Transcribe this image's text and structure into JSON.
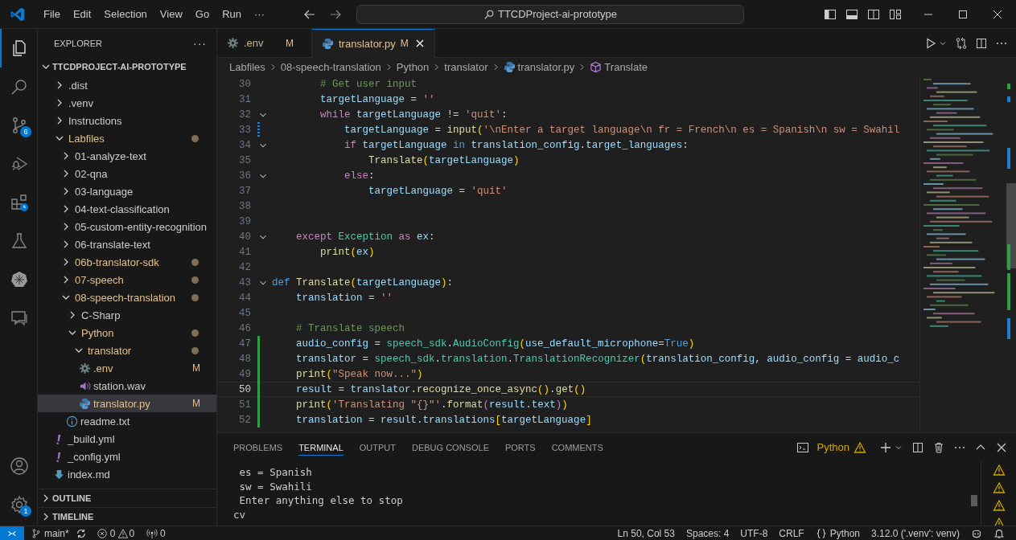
{
  "title_bar": {
    "menus": [
      "File",
      "Edit",
      "Selection",
      "View",
      "Go",
      "Run",
      "···"
    ],
    "search": "TTCDProject-ai-prototype"
  },
  "activity_bar": {
    "items": [
      {
        "kind": "explorer",
        "selected": true
      },
      {
        "kind": "search",
        "selected": false
      },
      {
        "kind": "source-control",
        "selected": false,
        "badge": "6"
      },
      {
        "kind": "run",
        "selected": false
      },
      {
        "kind": "extensions",
        "selected": false
      },
      {
        "kind": "testing",
        "selected": false
      },
      {
        "kind": "kubernetes",
        "selected": false
      },
      {
        "kind": "chat",
        "selected": false
      }
    ],
    "bottom": [
      {
        "kind": "account"
      },
      {
        "kind": "settings",
        "badge": "1"
      }
    ]
  },
  "sidebar": {
    "title": "EXPLORER",
    "more": "···",
    "root": {
      "name": "TTCDPROJECT-AI-PROTOTYPE",
      "expanded": true,
      "children": [
        {
          "name": ".dist",
          "kind": "folder",
          "expanded": false,
          "modified": false,
          "selected": false
        },
        {
          "name": ".venv",
          "kind": "folder",
          "expanded": false,
          "modified": false,
          "selected": false
        },
        {
          "name": "Instructions",
          "kind": "folder",
          "expanded": false,
          "modified": false,
          "selected": false
        },
        {
          "name": "Labfiles",
          "kind": "folder",
          "expanded": true,
          "modified": true,
          "selected": false,
          "children": [
            {
              "name": "01-analyze-text",
              "kind": "folder",
              "expanded": false,
              "modified": false,
              "selected": false
            },
            {
              "name": "02-qna",
              "kind": "folder",
              "expanded": false,
              "modified": false,
              "selected": false
            },
            {
              "name": "03-language",
              "kind": "folder",
              "expanded": false,
              "modified": false,
              "selected": false
            },
            {
              "name": "04-text-classification",
              "kind": "folder",
              "expanded": false,
              "modified": false,
              "selected": false
            },
            {
              "name": "05-custom-entity-recognition",
              "kind": "folder",
              "expanded": false,
              "modified": false,
              "selected": false
            },
            {
              "name": "06-translate-text",
              "kind": "folder",
              "expanded": false,
              "modified": false,
              "selected": false
            },
            {
              "name": "06b-translator-sdk",
              "kind": "folder",
              "expanded": false,
              "modified": true,
              "selected": false
            },
            {
              "name": "07-speech",
              "kind": "folder",
              "expanded": false,
              "modified": true,
              "selected": false
            },
            {
              "name": "08-speech-translation",
              "kind": "folder",
              "expanded": true,
              "modified": true,
              "selected": false,
              "children": [
                {
                  "name": "C-Sharp",
                  "kind": "folder",
                  "expanded": false,
                  "modified": false,
                  "selected": false
                },
                {
                  "name": "Python",
                  "kind": "folder",
                  "expanded": true,
                  "modified": true,
                  "selected": false,
                  "children": [
                    {
                      "name": "translator",
                      "kind": "folder",
                      "expanded": true,
                      "modified": true,
                      "selected": false,
                      "children": [
                        {
                          "name": ".env",
                          "kind": "config",
                          "modified": true,
                          "badge": "M",
                          "selected": false
                        },
                        {
                          "name": "station.wav",
                          "kind": "audio",
                          "modified": false,
                          "selected": false
                        },
                        {
                          "name": "translator.py",
                          "kind": "python",
                          "modified": true,
                          "badge": "M",
                          "selected": true
                        }
                      ]
                    }
                  ]
                },
                {
                  "name": "readme.txt",
                  "kind": "info",
                  "modified": false,
                  "selected": false
                }
              ]
            }
          ]
        },
        {
          "name": "_build.yml",
          "kind": "yaml",
          "modified": false,
          "selected": false
        },
        {
          "name": "_config.yml",
          "kind": "yaml",
          "modified": false,
          "selected": false
        },
        {
          "name": "index.md",
          "kind": "markdown",
          "modified": false,
          "selected": false
        }
      ]
    },
    "sections": [
      {
        "name": "OUTLINE",
        "expanded": false
      },
      {
        "name": "TIMELINE",
        "expanded": false
      }
    ]
  },
  "tabs": [
    {
      "name": ".env",
      "kind": "config",
      "badge": "M",
      "selected": false
    },
    {
      "name": "translator.py",
      "kind": "python",
      "badge": "M",
      "selected": true
    }
  ],
  "breadcrumbs": [
    {
      "text": "Labfiles",
      "kind": "folder"
    },
    {
      "text": "08-speech-translation",
      "kind": "folder"
    },
    {
      "text": "Python",
      "kind": "folder"
    },
    {
      "text": "translator",
      "kind": "folder"
    },
    {
      "text": "translator.py",
      "kind": "python"
    },
    {
      "text": "Translate",
      "kind": "symbol"
    }
  ],
  "code": [
    {
      "number": "30",
      "tokens": [
        {
          "text": "        # Get user input",
          "kind": "comment"
        }
      ]
    },
    {
      "number": "31",
      "tokens": [
        {
          "text": "        targetLanguage",
          "kind": "variable"
        },
        {
          "text": " = ",
          "kind": "plain"
        },
        {
          "text": "''",
          "kind": "string"
        }
      ]
    },
    {
      "number": "32",
      "fold": true,
      "tokens": [
        {
          "text": "        while",
          "kind": "control"
        },
        {
          "text": " targetLanguage",
          "kind": "variable"
        },
        {
          "text": " != ",
          "kind": "plain"
        },
        {
          "text": "'quit'",
          "kind": "string"
        },
        {
          "text": ":",
          "kind": "plain"
        }
      ]
    },
    {
      "number": "33",
      "modified": true,
      "tokens": [
        {
          "text": "            targetLanguage",
          "kind": "variable"
        },
        {
          "text": " = ",
          "kind": "plain"
        },
        {
          "text": "input",
          "kind": "function"
        },
        {
          "text": "(",
          "kind": "bracket"
        },
        {
          "text": "'\\nEnter a target language\\n fr = French\\n es = Spanish\\n sw = Swahil",
          "kind": "string"
        }
      ]
    },
    {
      "number": "34",
      "fold": true,
      "tokens": [
        {
          "text": "            if",
          "kind": "control"
        },
        {
          "text": " targetLanguage",
          "kind": "variable"
        },
        {
          "text": " in",
          "kind": "keyword"
        },
        {
          "text": " translation_config",
          "kind": "variable"
        },
        {
          "text": ".",
          "kind": "plain"
        },
        {
          "text": "target_languages",
          "kind": "variable"
        },
        {
          "text": ":",
          "kind": "plain"
        }
      ]
    },
    {
      "number": "35",
      "tokens": [
        {
          "text": "                Translate",
          "kind": "function"
        },
        {
          "text": "(",
          "kind": "bracket"
        },
        {
          "text": "targetLanguage",
          "kind": "variable"
        },
        {
          "text": ")",
          "kind": "bracket"
        }
      ]
    },
    {
      "number": "36",
      "fold": true,
      "tokens": [
        {
          "text": "            else",
          "kind": "control"
        },
        {
          "text": ":",
          "kind": "plain"
        }
      ]
    },
    {
      "number": "37",
      "tokens": [
        {
          "text": "                targetLanguage",
          "kind": "variable"
        },
        {
          "text": " = ",
          "kind": "plain"
        },
        {
          "text": "'quit'",
          "kind": "string"
        }
      ]
    },
    {
      "number": "38"
    },
    {
      "number": "39"
    },
    {
      "number": "40",
      "fold": true,
      "tokens": [
        {
          "text": "    except",
          "kind": "control"
        },
        {
          "text": " Exception",
          "kind": "type"
        },
        {
          "text": " as",
          "kind": "control"
        },
        {
          "text": " ex",
          "kind": "variable"
        },
        {
          "text": ":",
          "kind": "plain"
        }
      ]
    },
    {
      "number": "41",
      "tokens": [
        {
          "text": "        print",
          "kind": "function"
        },
        {
          "text": "(",
          "kind": "bracket"
        },
        {
          "text": "ex",
          "kind": "variable"
        },
        {
          "text": ")",
          "kind": "bracket"
        }
      ]
    },
    {
      "number": "42"
    },
    {
      "number": "43",
      "fold": true,
      "tokens": [
        {
          "text": "def",
          "kind": "keyword"
        },
        {
          "text": " Translate",
          "kind": "function"
        },
        {
          "text": "(",
          "kind": "bracket"
        },
        {
          "text": "targetLanguage",
          "kind": "variable"
        },
        {
          "text": ")",
          "kind": "bracket"
        },
        {
          "text": ":",
          "kind": "plain"
        }
      ]
    },
    {
      "number": "44",
      "tokens": [
        {
          "text": "    translation",
          "kind": "variable"
        },
        {
          "text": " = ",
          "kind": "plain"
        },
        {
          "text": "''",
          "kind": "string"
        }
      ]
    },
    {
      "number": "45"
    },
    {
      "number": "46",
      "tokens": [
        {
          "text": "    # Translate speech",
          "kind": "comment"
        }
      ]
    },
    {
      "number": "47",
      "added": true,
      "tokens": [
        {
          "text": "    audio_config",
          "kind": "variable"
        },
        {
          "text": " = ",
          "kind": "plain"
        },
        {
          "text": "speech_sdk",
          "kind": "type"
        },
        {
          "text": ".",
          "kind": "plain"
        },
        {
          "text": "AudioConfig",
          "kind": "type"
        },
        {
          "text": "(",
          "kind": "bracket"
        },
        {
          "text": "use_default_microphone",
          "kind": "variable"
        },
        {
          "text": "=",
          "kind": "plain"
        },
        {
          "text": "True",
          "kind": "keyword"
        },
        {
          "text": ")",
          "kind": "bracket"
        }
      ]
    },
    {
      "number": "48",
      "added": true,
      "tokens": [
        {
          "text": "    translator",
          "kind": "variable"
        },
        {
          "text": " = ",
          "kind": "plain"
        },
        {
          "text": "speech_sdk",
          "kind": "type"
        },
        {
          "text": ".",
          "kind": "plain"
        },
        {
          "text": "translation",
          "kind": "type"
        },
        {
          "text": ".",
          "kind": "plain"
        },
        {
          "text": "TranslationRecognizer",
          "kind": "type"
        },
        {
          "text": "(",
          "kind": "bracket"
        },
        {
          "text": "translation_config",
          "kind": "variable"
        },
        {
          "text": ", ",
          "kind": "plain"
        },
        {
          "text": "audio_config",
          "kind": "variable"
        },
        {
          "text": " = ",
          "kind": "plain"
        },
        {
          "text": "audio_c",
          "kind": "variable"
        }
      ]
    },
    {
      "number": "49",
      "added": true,
      "tokens": [
        {
          "text": "    print",
          "kind": "function"
        },
        {
          "text": "(",
          "kind": "bracket"
        },
        {
          "text": "\"Speak now...\"",
          "kind": "string"
        },
        {
          "text": ")",
          "kind": "bracket"
        }
      ]
    },
    {
      "number": "50",
      "added": true,
      "current": true,
      "tokens": [
        {
          "text": "    result",
          "kind": "variable"
        },
        {
          "text": " = ",
          "kind": "plain"
        },
        {
          "text": "translator",
          "kind": "variable"
        },
        {
          "text": ".",
          "kind": "plain"
        },
        {
          "text": "recognize_once_async",
          "kind": "function"
        },
        {
          "text": "()",
          "kind": "bracket"
        },
        {
          "text": ".",
          "kind": "plain"
        },
        {
          "text": "get",
          "kind": "function"
        },
        {
          "text": "()",
          "kind": "bracket"
        }
      ]
    },
    {
      "number": "51",
      "added": true,
      "tokens": [
        {
          "text": "    print",
          "kind": "function"
        },
        {
          "text": "(",
          "kind": "bracket"
        },
        {
          "text": "'Translating \"{}\"'",
          "kind": "string"
        },
        {
          "text": ".",
          "kind": "plain"
        },
        {
          "text": "format",
          "kind": "function"
        },
        {
          "text": "(",
          "kind": "bracket2"
        },
        {
          "text": "result",
          "kind": "variable"
        },
        {
          "text": ".",
          "kind": "plain"
        },
        {
          "text": "text",
          "kind": "variable"
        },
        {
          "text": ")",
          "kind": "bracket2"
        },
        {
          "text": ")",
          "kind": "bracket"
        }
      ]
    },
    {
      "number": "52",
      "added": true,
      "tokens": [
        {
          "text": "    translation",
          "kind": "variable"
        },
        {
          "text": " = ",
          "kind": "plain"
        },
        {
          "text": "result",
          "kind": "variable"
        },
        {
          "text": ".",
          "kind": "plain"
        },
        {
          "text": "translations",
          "kind": "variable"
        },
        {
          "text": "[",
          "kind": "bracket"
        },
        {
          "text": "targetLanguage",
          "kind": "variable"
        },
        {
          "text": "]",
          "kind": "bracket"
        }
      ]
    }
  ],
  "panel": {
    "tabs": [
      {
        "label": "PROBLEMS",
        "selected": false
      },
      {
        "label": "TERMINAL",
        "selected": true
      },
      {
        "label": "OUTPUT",
        "selected": false
      },
      {
        "label": "DEBUG CONSOLE",
        "selected": false
      },
      {
        "label": "PORTS",
        "selected": false
      },
      {
        "label": "COMMENTS",
        "selected": false
      }
    ],
    "terminal_name": "Python",
    "terminal_lines": [
      " es = Spanish",
      " sw = Swahili",
      " Enter anything else to stop",
      "cv"
    ],
    "instances": [
      {
        "warning": true
      },
      {
        "warning": true
      },
      {
        "warning": true
      },
      {
        "warning": true
      }
    ]
  },
  "status_bar": {
    "branch": "main*",
    "errors": "0",
    "warnings": "0",
    "ports": "0",
    "right": [
      {
        "text": "Ln 50, Col 53",
        "kind": "plain"
      },
      {
        "text": "Spaces: 4",
        "kind": "plain"
      },
      {
        "text": "UTF-8",
        "kind": "plain"
      },
      {
        "text": "CRLF",
        "kind": "plain"
      },
      {
        "text": "Python",
        "kind": "language"
      },
      {
        "text": "3.12.0 ('.venv': venv)",
        "kind": "plain"
      }
    ]
  }
}
